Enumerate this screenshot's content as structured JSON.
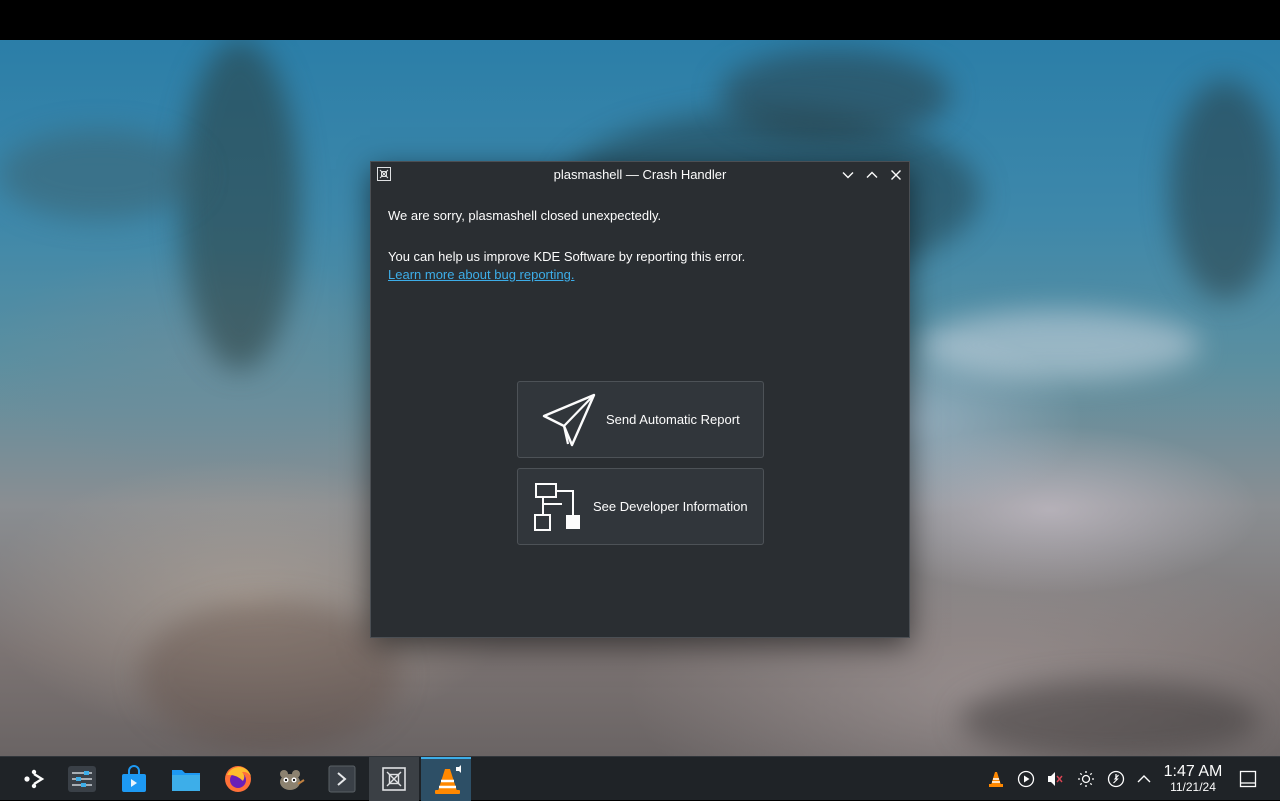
{
  "window": {
    "title": "plasmashell — Crash Handler",
    "message1": "We are sorry, plasmashell closed unexpectedly.",
    "message2": "You can help us improve KDE Software by reporting this error.",
    "link": "Learn more about bug reporting.",
    "send_report_label": "Send Automatic Report",
    "developer_info_label": "See Developer Information"
  },
  "taskbar": {
    "apps": [
      "application-launcher-icon",
      "system-settings-icon",
      "discover-store-icon",
      "dolphin-files-icon",
      "firefox-icon",
      "gimp-icon",
      "konsole-icon",
      "crash-handler-task-icon",
      "vlc-task-icon"
    ],
    "tray": [
      "vlc-tray-icon",
      "media-player-icon",
      "volume-muted-icon",
      "brightness-icon",
      "power-icon",
      "show-hidden-icons-chevron"
    ]
  },
  "clock": {
    "time": "1:47 AM",
    "date": "11/21/24"
  },
  "colors": {
    "accent": "#3daee9",
    "window_bg": "#2a2e32",
    "button_bg": "#31363b",
    "taskbar_bg": "#1f2327"
  }
}
